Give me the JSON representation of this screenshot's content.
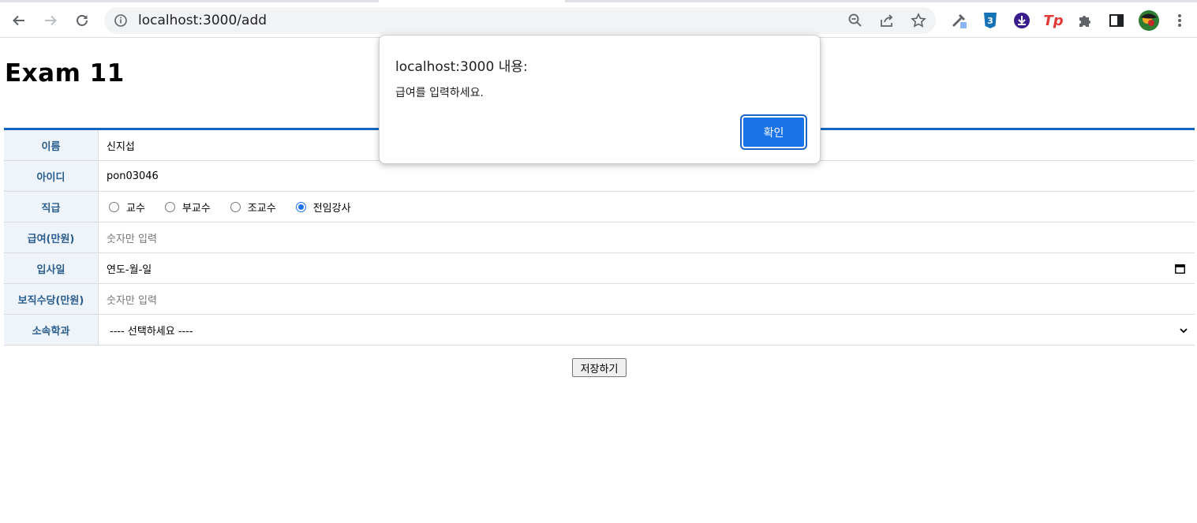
{
  "browser": {
    "url": "localhost:3000/add",
    "extensions": [
      "eyedropper-icon",
      "css3-icon",
      "download-icon",
      "tp-icon",
      "puzzle-icon",
      "sidepanel-icon",
      "avatar",
      "menu-icon"
    ],
    "tp_label": "Tp",
    "css_label": "3"
  },
  "page": {
    "title": "Exam 11",
    "form": {
      "rows": [
        {
          "label": "이름",
          "value": "신지섭"
        },
        {
          "label": "아이디",
          "value": "pon03046"
        },
        {
          "label": "직급",
          "options": [
            "교수",
            "부교수",
            "조교수",
            "전임강사"
          ],
          "selected": "전임강사"
        },
        {
          "label": "급여(만원)",
          "placeholder": "숫자만 입력"
        },
        {
          "label": "입사일",
          "placeholder": "연도-월-일"
        },
        {
          "label": "보직수당(만원)",
          "placeholder": "숫자만 입력"
        },
        {
          "label": "소속학과",
          "selected": "---- 선택하세요 ----"
        }
      ],
      "submit_label": "저장하기"
    }
  },
  "dialog": {
    "title": "localhost:3000 내용:",
    "message": "급여를 입력하세요.",
    "ok_label": "확인"
  },
  "colors": {
    "accent": "#1a73e8",
    "table_border": "#1565c0",
    "label_bg": "#eef4f9",
    "label_text": "#2a5d8f"
  }
}
